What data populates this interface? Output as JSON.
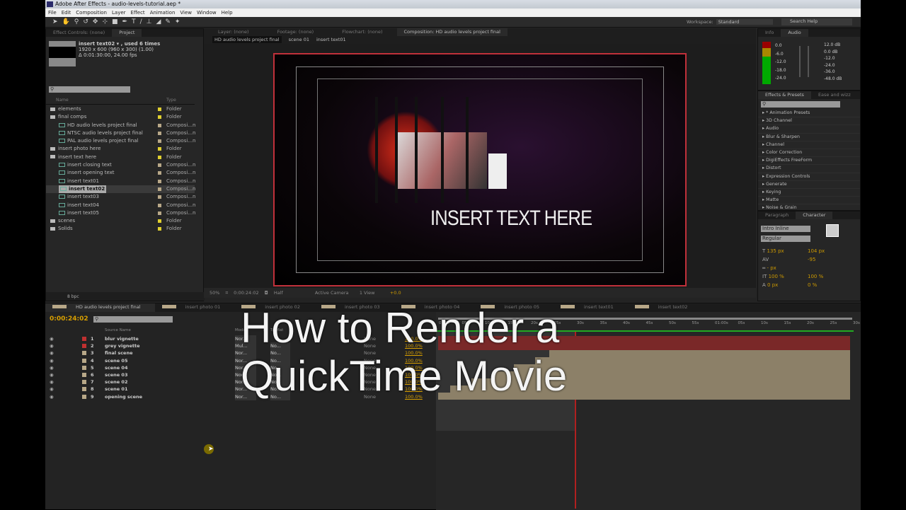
{
  "window": {
    "title": "Adobe After Effects - audio-levels-tutorial.aep *"
  },
  "menu": [
    "File",
    "Edit",
    "Composition",
    "Layer",
    "Effect",
    "Animation",
    "View",
    "Window",
    "Help"
  ],
  "toolbar": {
    "workspace_label": "Workspace:",
    "workspace_value": "Standard",
    "search_help": "Search Help"
  },
  "project": {
    "tabs": [
      "Effect Controls: (none)",
      "Project"
    ],
    "selected_name": "insert text02 ▾ , used 6 times",
    "selected_dims": "1920 x 600  (960 x 300) (1.00)",
    "selected_duration": "Δ 0:01:30:00, 24.00 fps",
    "col_name": "Name",
    "col_type": "Type",
    "items": [
      {
        "name": "elements",
        "type": "Folder",
        "kind": "folder",
        "indent": 0
      },
      {
        "name": "final comps",
        "type": "Folder",
        "kind": "folder",
        "indent": 0
      },
      {
        "name": "HD audio levels project final",
        "type": "Composi...n",
        "kind": "comp",
        "indent": 1
      },
      {
        "name": "NTSC audio levels project final",
        "type": "Composi...n",
        "kind": "comp",
        "indent": 1
      },
      {
        "name": "PAL audio levels project final",
        "type": "Composi...n",
        "kind": "comp",
        "indent": 1
      },
      {
        "name": "insert photo here",
        "type": "Folder",
        "kind": "folder",
        "indent": 0
      },
      {
        "name": "insert text here",
        "type": "Folder",
        "kind": "folder",
        "indent": 0
      },
      {
        "name": "insert closing text",
        "type": "Composi...n",
        "kind": "comp",
        "indent": 1
      },
      {
        "name": "insert opening text",
        "type": "Composi...n",
        "kind": "comp",
        "indent": 1
      },
      {
        "name": "insert text01",
        "type": "Composi...n",
        "kind": "comp",
        "indent": 1
      },
      {
        "name": "insert text02",
        "type": "Composi...n",
        "kind": "comp",
        "indent": 1,
        "selected": true
      },
      {
        "name": "insert text03",
        "type": "Composi...n",
        "kind": "comp",
        "indent": 1
      },
      {
        "name": "insert text04",
        "type": "Composi...n",
        "kind": "comp",
        "indent": 1
      },
      {
        "name": "insert text05",
        "type": "Composi...n",
        "kind": "comp",
        "indent": 1
      },
      {
        "name": "scenes",
        "type": "Folder",
        "kind": "folder",
        "indent": 0
      },
      {
        "name": "Solids",
        "type": "Folder",
        "kind": "folder",
        "indent": 0
      }
    ],
    "bpc": "8 bpc"
  },
  "viewer": {
    "tabs": [
      "Layer: (none)",
      "Footage: (none)",
      "Flowchart: (none)",
      "Composition: HD audio levels project final"
    ],
    "breadcrumbs": [
      "HD audio levels project final",
      "scene 01",
      "insert text01"
    ],
    "comp_text": "INSERT TEXT HERE",
    "zoom": "50%",
    "timecode": "0:00:24:02",
    "resolution": "Half",
    "camera": "Active Camera",
    "views": "1 View",
    "exposure": "+0.0"
  },
  "audio": {
    "tabs": [
      "Info",
      "Audio"
    ],
    "levels": [
      "0.0",
      "-6.0",
      "-12.0",
      "-18.0",
      "-24.0"
    ],
    "db": [
      "12.0 dB",
      "0.0 dB",
      "-12.0",
      "-24.0",
      "-36.0",
      "-48.0 dB"
    ]
  },
  "effects": {
    "tabs": [
      "Effects & Presets",
      "Ease and wizz"
    ],
    "items": [
      "* Animation Presets",
      "3D Channel",
      "Audio",
      "Blur & Sharpen",
      "Channel",
      "Color Correction",
      "DigiEffects FreeForm",
      "Distort",
      "Expression Controls",
      "Generate",
      "Keying",
      "Matte",
      "Noise & Grain"
    ]
  },
  "character": {
    "tabs": [
      "Paragraph",
      "Character"
    ],
    "font": "Intro Inline",
    "style": "Regular",
    "size": "135 px",
    "leading": "104 px",
    "tracking": "-95",
    "stroke": "- px",
    "vscale": "100 %",
    "hscale": "100 %",
    "baseline": "0 px",
    "tsume": "0 %"
  },
  "timeline": {
    "tabs": [
      "HD audio levels project final",
      "insert photo 01",
      "insert photo 02",
      "insert photo 03",
      "insert photo 04",
      "insert photo 05",
      "insert text01",
      "insert text02"
    ],
    "timecode": "0:00:24:02",
    "col_source": "Source Name",
    "col_mode": "Mode",
    "col_t": "T",
    "col_trkmat": "TrkMat",
    "layers": [
      {
        "num": "1",
        "name": "blur vignette",
        "mode": "Nor...",
        "trk": "",
        "color": "#c03030",
        "stretch": "100.0%"
      },
      {
        "num": "2",
        "name": "grey vignette",
        "mode": "Mul...",
        "trk": "No...",
        "color": "#c03030",
        "stretch": "100.0%"
      },
      {
        "num": "3",
        "name": "final scene",
        "mode": "Nor...",
        "trk": "No...",
        "color": "#b8a888",
        "stretch": "100.0%"
      },
      {
        "num": "4",
        "name": "scene 05",
        "mode": "Nor...",
        "trk": "No...",
        "color": "#b8a888",
        "stretch": "100.0%"
      },
      {
        "num": "5",
        "name": "scene 04",
        "mode": "Nor...",
        "trk": "No...",
        "color": "#b8a888",
        "stretch": "100.0%"
      },
      {
        "num": "6",
        "name": "scene 03",
        "mode": "Nor...",
        "trk": "No...",
        "color": "#b8a888",
        "stretch": "100.0%"
      },
      {
        "num": "7",
        "name": "scene 02",
        "mode": "Nor...",
        "trk": "No...",
        "color": "#b8a888",
        "stretch": "100.0%"
      },
      {
        "num": "8",
        "name": "scene 01",
        "mode": "Nor...",
        "trk": "No...",
        "color": "#b8a888",
        "stretch": "100.0%"
      },
      {
        "num": "9",
        "name": "opening scene",
        "mode": "Nor...",
        "trk": "No...",
        "color": "#b8a888",
        "stretch": "100.0%"
      }
    ],
    "ruler": [
      "0:00s",
      "05s",
      "10s",
      "15s",
      "20s",
      "25s",
      "30s",
      "35s",
      "40s",
      "45s",
      "50s",
      "55s",
      "01:00s",
      "05s",
      "10s",
      "15s",
      "20s",
      "25s",
      "30s"
    ],
    "parent": "None",
    "playhead_seconds": 24.08
  },
  "overlay": {
    "line1": "How to Render a",
    "line2": "QuickTime Movie"
  }
}
